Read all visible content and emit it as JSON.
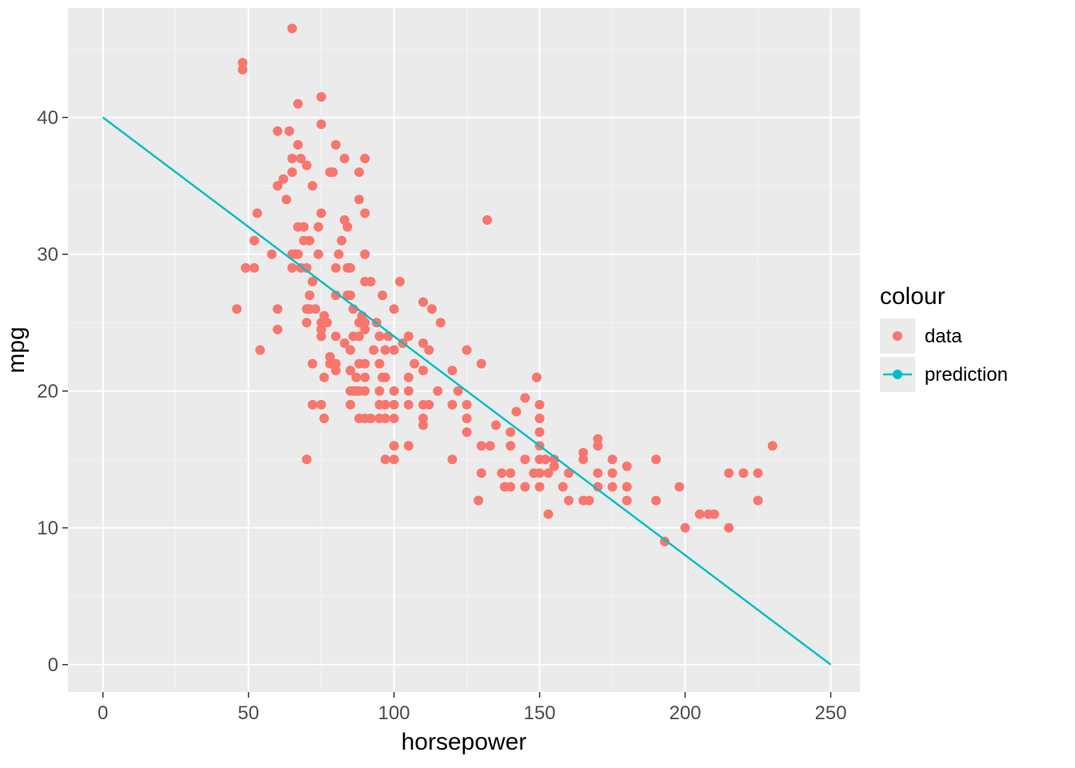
{
  "chart_data": {
    "type": "scatter",
    "xlabel": "horsepower",
    "ylabel": "mpg",
    "legend_title": "colour",
    "series": [
      {
        "name": "data",
        "color": "#F8766D",
        "kind": "points"
      },
      {
        "name": "prediction",
        "color": "#00BFC4",
        "kind": "line"
      }
    ],
    "xlim": [
      -12,
      260
    ],
    "ylim": [
      -2,
      48
    ],
    "x_ticks": [
      0,
      50,
      100,
      150,
      200,
      250
    ],
    "y_ticks": [
      0,
      10,
      20,
      30,
      40
    ],
    "x_minor": [
      25,
      75,
      125,
      175,
      225
    ],
    "y_minor": [
      5,
      15,
      25,
      35,
      45
    ],
    "prediction_line": {
      "x": [
        0,
        250
      ],
      "y": [
        40,
        0
      ]
    },
    "data_points": [
      [
        46,
        26
      ],
      [
        48,
        43.5
      ],
      [
        48,
        44
      ],
      [
        49,
        29
      ],
      [
        52,
        31
      ],
      [
        52,
        29
      ],
      [
        53,
        33
      ],
      [
        54,
        23
      ],
      [
        58,
        30
      ],
      [
        60,
        24.5
      ],
      [
        60,
        26
      ],
      [
        60,
        35
      ],
      [
        60,
        39
      ],
      [
        62,
        35.5
      ],
      [
        63,
        34
      ],
      [
        64,
        39
      ],
      [
        65,
        36
      ],
      [
        65,
        30
      ],
      [
        65,
        29
      ],
      [
        65,
        46.5
      ],
      [
        65,
        37
      ],
      [
        66,
        30
      ],
      [
        67,
        38
      ],
      [
        67,
        41
      ],
      [
        67,
        32
      ],
      [
        67,
        30
      ],
      [
        68,
        29
      ],
      [
        68,
        37
      ],
      [
        69,
        31
      ],
      [
        69,
        32
      ],
      [
        70,
        26
      ],
      [
        70,
        36.5
      ],
      [
        70,
        25
      ],
      [
        70,
        29
      ],
      [
        70,
        15
      ],
      [
        71,
        26
      ],
      [
        71,
        27
      ],
      [
        71,
        31
      ],
      [
        72,
        35
      ],
      [
        72,
        22
      ],
      [
        72,
        19
      ],
      [
        72,
        28
      ],
      [
        73,
        26
      ],
      [
        74,
        30
      ],
      [
        74,
        32
      ],
      [
        75,
        33
      ],
      [
        75,
        39.5
      ],
      [
        75,
        24
      ],
      [
        75,
        25
      ],
      [
        75,
        19
      ],
      [
        75,
        41.5
      ],
      [
        75,
        24.5
      ],
      [
        76,
        18
      ],
      [
        76,
        25.5
      ],
      [
        76,
        21
      ],
      [
        77,
        25
      ],
      [
        78,
        36
      ],
      [
        78,
        22
      ],
      [
        78,
        22.5
      ],
      [
        79,
        36
      ],
      [
        80,
        21.5
      ],
      [
        80,
        22
      ],
      [
        80,
        27
      ],
      [
        80,
        29
      ],
      [
        80,
        38
      ],
      [
        80,
        24
      ],
      [
        81,
        30
      ],
      [
        82,
        31
      ],
      [
        83,
        23.5
      ],
      [
        83,
        32.5
      ],
      [
        83,
        37
      ],
      [
        84,
        27
      ],
      [
        84,
        29
      ],
      [
        84,
        32
      ],
      [
        85,
        19
      ],
      [
        85,
        20
      ],
      [
        85,
        23
      ],
      [
        85,
        27
      ],
      [
        85,
        29
      ],
      [
        85,
        21.5
      ],
      [
        86,
        20
      ],
      [
        86,
        24
      ],
      [
        86,
        26
      ],
      [
        87,
        21
      ],
      [
        87,
        20
      ],
      [
        88,
        25
      ],
      [
        88,
        18
      ],
      [
        88,
        36
      ],
      [
        88,
        20
      ],
      [
        88,
        22
      ],
      [
        88,
        34
      ],
      [
        88,
        24
      ],
      [
        89,
        25.5
      ],
      [
        90,
        18
      ],
      [
        90,
        20
      ],
      [
        90,
        22
      ],
      [
        90,
        24.5
      ],
      [
        90,
        25
      ],
      [
        90,
        28
      ],
      [
        90,
        30
      ],
      [
        90,
        33
      ],
      [
        90,
        37
      ],
      [
        90,
        21
      ],
      [
        92,
        28
      ],
      [
        92,
        18
      ],
      [
        93,
        23
      ],
      [
        94,
        25
      ],
      [
        95,
        20
      ],
      [
        95,
        24
      ],
      [
        95,
        22
      ],
      [
        95,
        19
      ],
      [
        95,
        18
      ],
      [
        96,
        27
      ],
      [
        96,
        21
      ],
      [
        97,
        19
      ],
      [
        97,
        18
      ],
      [
        97,
        21
      ],
      [
        97,
        23
      ],
      [
        97,
        15
      ],
      [
        98,
        24
      ],
      [
        100,
        19
      ],
      [
        100,
        23
      ],
      [
        100,
        26
      ],
      [
        100,
        15
      ],
      [
        100,
        20
      ],
      [
        100,
        16
      ],
      [
        100,
        23
      ],
      [
        100,
        18
      ],
      [
        102,
        28
      ],
      [
        103,
        23.5
      ],
      [
        105,
        19
      ],
      [
        105,
        20
      ],
      [
        105,
        21
      ],
      [
        105,
        16
      ],
      [
        105,
        24
      ],
      [
        107,
        22
      ],
      [
        110,
        17.5
      ],
      [
        110,
        26.5
      ],
      [
        110,
        19
      ],
      [
        110,
        23.5
      ],
      [
        110,
        21.5
      ],
      [
        110,
        18
      ],
      [
        112,
        23
      ],
      [
        112,
        19
      ],
      [
        113,
        26
      ],
      [
        115,
        20
      ],
      [
        116,
        25
      ],
      [
        120,
        19
      ],
      [
        120,
        21.5
      ],
      [
        120,
        15
      ],
      [
        122,
        20
      ],
      [
        125,
        23
      ],
      [
        125,
        17
      ],
      [
        125,
        18
      ],
      [
        125,
        19
      ],
      [
        129,
        12
      ],
      [
        130,
        16
      ],
      [
        130,
        22
      ],
      [
        130,
        14
      ],
      [
        132,
        32.5
      ],
      [
        133,
        16
      ],
      [
        135,
        17.5
      ],
      [
        137,
        14
      ],
      [
        138,
        13
      ],
      [
        140,
        14
      ],
      [
        140,
        16
      ],
      [
        140,
        13
      ],
      [
        140,
        17
      ],
      [
        142,
        18.5
      ],
      [
        145,
        19.5
      ],
      [
        145,
        13
      ],
      [
        145,
        15
      ],
      [
        148,
        14
      ],
      [
        149,
        21
      ],
      [
        150,
        13
      ],
      [
        150,
        14
      ],
      [
        150,
        15
      ],
      [
        150,
        16
      ],
      [
        150,
        17
      ],
      [
        150,
        18
      ],
      [
        150,
        19
      ],
      [
        152,
        15
      ],
      [
        153,
        14
      ],
      [
        153,
        11
      ],
      [
        155,
        14.5
      ],
      [
        155,
        15
      ],
      [
        158,
        13
      ],
      [
        160,
        12
      ],
      [
        160,
        14
      ],
      [
        165,
        12
      ],
      [
        165,
        15
      ],
      [
        165,
        15.5
      ],
      [
        167,
        12
      ],
      [
        170,
        13
      ],
      [
        170,
        14
      ],
      [
        170,
        16
      ],
      [
        170,
        16.5
      ],
      [
        175,
        13
      ],
      [
        175,
        14
      ],
      [
        175,
        15
      ],
      [
        180,
        12
      ],
      [
        180,
        13
      ],
      [
        180,
        14.5
      ],
      [
        190,
        15
      ],
      [
        190,
        12
      ],
      [
        193,
        9
      ],
      [
        198,
        13
      ],
      [
        200,
        10
      ],
      [
        205,
        11
      ],
      [
        208,
        11
      ],
      [
        210,
        11
      ],
      [
        215,
        10
      ],
      [
        215,
        14
      ],
      [
        220,
        14
      ],
      [
        225,
        12
      ],
      [
        225,
        14
      ],
      [
        230,
        16
      ]
    ]
  }
}
